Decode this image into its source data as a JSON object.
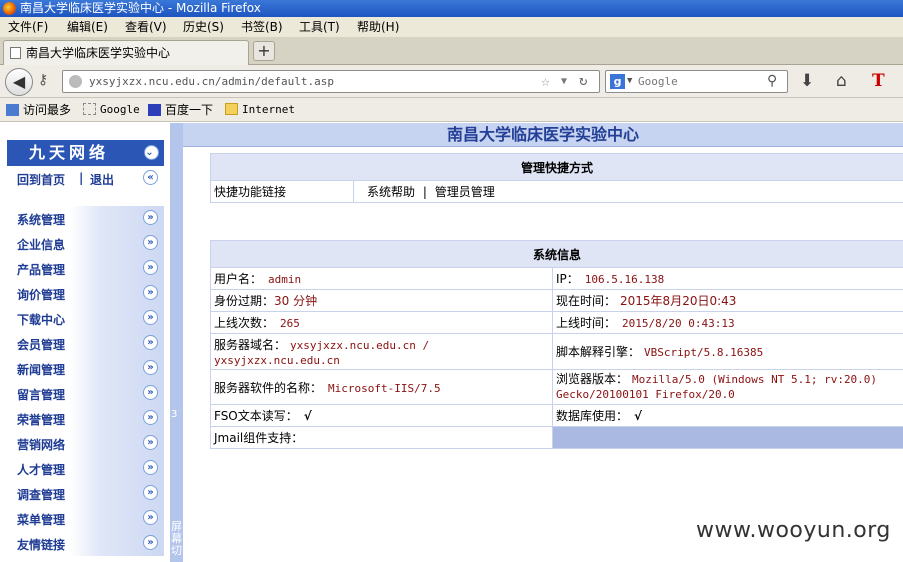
{
  "window": {
    "title": "南昌大学临床医学实验中心 - Mozilla Firefox"
  },
  "menu": [
    "文件(F)",
    "编辑(E)",
    "查看(V)",
    "历史(S)",
    "书签(B)",
    "工具(T)",
    "帮助(H)"
  ],
  "tab": {
    "label": "南昌大学临床医学实验中心",
    "new_tab": "+"
  },
  "nav": {
    "url": "yxsyjxzx.ncu.edu.cn/admin/default.asp",
    "search_placeholder": "Google"
  },
  "bookmarks": [
    "访问最多",
    "Google",
    "百度一下",
    "Internet"
  ],
  "sidebar": {
    "header": "九天网络",
    "home_link": "回到首页",
    "separator": "|",
    "logout_link": "退出",
    "items": [
      "系统管理",
      "企业信息",
      "产品管理",
      "询价管理",
      "下载中心",
      "会员管理",
      "新闻管理",
      "留言管理",
      "荣誉管理",
      "营销网络",
      "人才管理",
      "调查管理",
      "菜单管理",
      "友情链接"
    ]
  },
  "splitter": {
    "label": "屏幕切",
    "number": "3"
  },
  "page": {
    "title": "南昌大学临床医学实验中心"
  },
  "shortcuts": {
    "header": "管理快捷方式",
    "label": "快捷功能链接",
    "link_help": "系统帮助",
    "sep": "|",
    "link_admin": "管理员管理"
  },
  "sysinfo": {
    "header": "系统信息",
    "username_label": "用户名：",
    "username": "admin",
    "ip_label": "IP：",
    "ip": "106.5.16.138",
    "expiry_label": "身份过期：",
    "expiry": "30 分钟",
    "now_label": "现在时间：",
    "now": "2015年8月20日0:43",
    "logins_label": "上线次数：",
    "logins": "265",
    "online_label": "上线时间：",
    "online": "2015/8/20 0:43:13",
    "domain_label": "服务器域名：",
    "domain": "yxsyjxzx.ncu.edu.cn / yxsyjxzx.ncu.edu.cn",
    "engine_label": "脚本解释引擎：",
    "engine": "VBScript/5.8.16385",
    "software_label": "服务器软件的名称：",
    "software": "Microsoft-IIS/7.5",
    "browser_label": "浏览器版本：",
    "browser": "Mozilla/5.0 (Windows NT 5.1; rv:20.0) Gecko/20100101 Firefox/20.0",
    "fso_label": "FSO文本读写：",
    "fso": "√",
    "db_label": "数据库使用：",
    "db": "√",
    "jmail_label": "Jmail组件支持："
  },
  "watermark": "www.wooyun.org"
}
